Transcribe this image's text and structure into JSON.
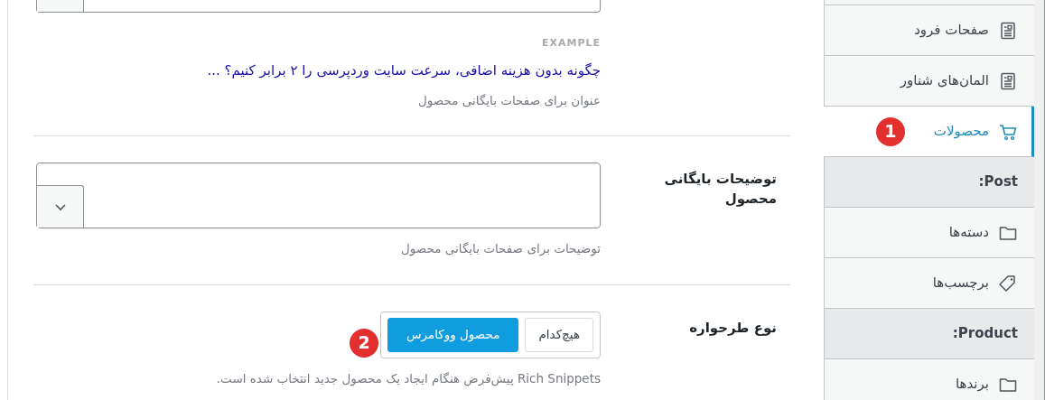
{
  "sections": [
    {
      "kind": "example",
      "example_label": "EXAMPLE",
      "example_text": "چگونه بدون هزینه اضافی، سرعت سایت وردپرسی را ۲ برابر کنیم؟ ...",
      "help": "عنوان برای صفحات بایگانی محصول"
    },
    {
      "kind": "textarea",
      "label": "توضیحات بایگانی محصول",
      "help": "توضیحات برای صفحات بایگانی محصول"
    },
    {
      "kind": "toggle",
      "label": "نوع طرحواره",
      "options": [
        {
          "label": "هیچ‌کدام",
          "selected": false
        },
        {
          "label": "محصول ووکامرس",
          "selected": true,
          "badge": "2"
        }
      ],
      "help": "Rich Snippets پیش‌فرض هنگام ایجاد یک محصول جدید انتخاب شده است."
    }
  ],
  "sidebar": {
    "items": [
      {
        "kind": "item",
        "label": "صفحات فرود",
        "selected": false
      },
      {
        "kind": "item",
        "label": "المان‌های شناور",
        "selected": false
      },
      {
        "kind": "item",
        "label": "محصولات",
        "selected": true,
        "badge": "1"
      },
      {
        "kind": "header",
        "label": "Post:"
      },
      {
        "kind": "item",
        "label": "دسته‌ها",
        "selected": false
      },
      {
        "kind": "item",
        "label": "برچسب‌ها",
        "selected": false
      },
      {
        "kind": "header",
        "label": "Product:"
      },
      {
        "kind": "item",
        "label": "برندها",
        "selected": false
      }
    ]
  }
}
